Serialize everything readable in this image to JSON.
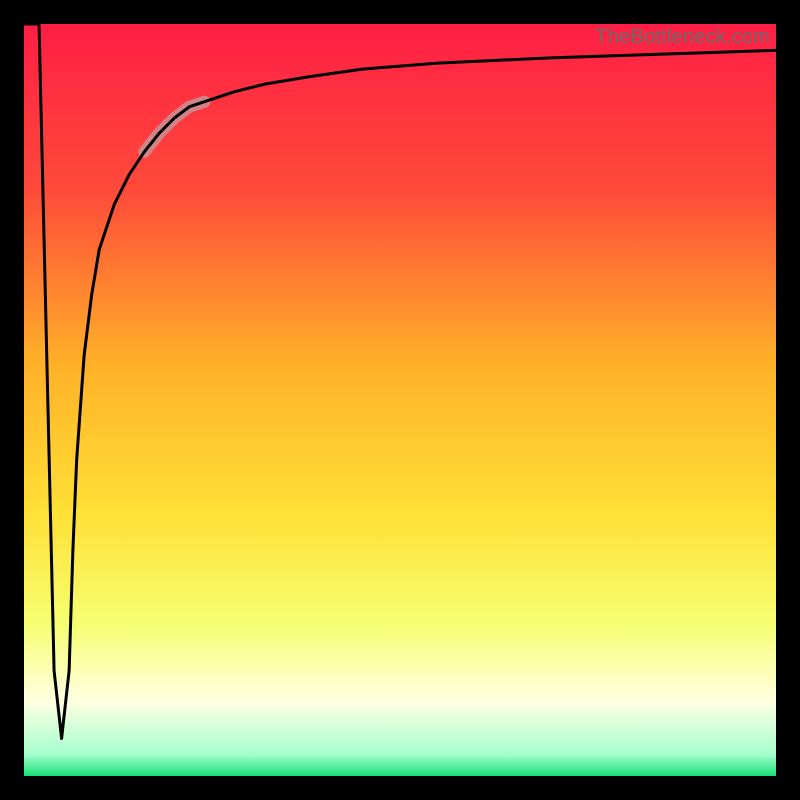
{
  "watermark": "TheBottleneck.com",
  "colors": {
    "frame": "#000000",
    "grad_top": "#ff1e45",
    "grad_mid_upper": "#ff7a2a",
    "grad_mid": "#ffd21f",
    "grad_lower": "#f6ff72",
    "grad_pale": "#ffffe0",
    "grad_bottom": "#18e07a",
    "curve": "#000000",
    "highlight": "#cc8d8d"
  },
  "chart_data": {
    "type": "line",
    "title": "",
    "xlabel": "",
    "ylabel": "",
    "xlim": [
      0,
      100
    ],
    "ylim": [
      0,
      100
    ],
    "series": [
      {
        "name": "curve",
        "x": [
          0,
          2,
          4,
          5,
          6,
          6.5,
          7,
          8,
          9,
          10,
          12,
          14,
          16,
          18,
          20,
          22,
          25,
          28,
          32,
          38,
          45,
          55,
          70,
          85,
          100
        ],
        "y": [
          100,
          100,
          14,
          5,
          14,
          30,
          42,
          56,
          64,
          70,
          76,
          80,
          83,
          85.5,
          87.5,
          89,
          90,
          91,
          92,
          93,
          94,
          94.8,
          95.5,
          96,
          96.5
        ]
      }
    ],
    "highlight_segment": {
      "series": "curve",
      "x_range": [
        16,
        24
      ],
      "stroke_width_px": 12
    },
    "gradient_stops": [
      {
        "pos": 0.0,
        "color": "#ff1e45"
      },
      {
        "pos": 0.22,
        "color": "#ff4a3a"
      },
      {
        "pos": 0.45,
        "color": "#ffb028"
      },
      {
        "pos": 0.65,
        "color": "#ffe035"
      },
      {
        "pos": 0.8,
        "color": "#f6ff72"
      },
      {
        "pos": 0.9,
        "color": "#ffffe0"
      },
      {
        "pos": 0.97,
        "color": "#a8ffcf"
      },
      {
        "pos": 1.0,
        "color": "#18e07a"
      }
    ]
  }
}
